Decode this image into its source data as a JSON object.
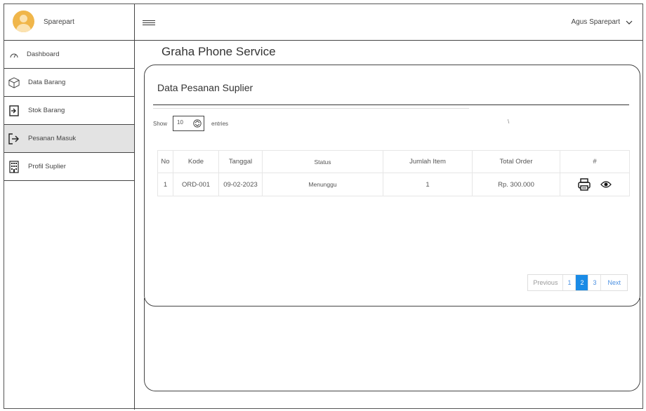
{
  "header": {
    "brand_name": "Sparepart",
    "user_name": "Agus Sparepart"
  },
  "sidebar": {
    "items": [
      {
        "label": "Dashboard",
        "icon": "dashboard-icon",
        "active": false
      },
      {
        "label": "Data Barang",
        "icon": "box-icon",
        "active": false
      },
      {
        "label": "Stok Barang",
        "icon": "login-icon",
        "active": false
      },
      {
        "label": "Pesanan Masuk",
        "icon": "arrow-in-icon",
        "active": true
      },
      {
        "label": "Profil Suplier",
        "icon": "building-icon",
        "active": false
      }
    ]
  },
  "main": {
    "page_title": "Graha Phone Service",
    "card_title": "Data Pesanan Suplier",
    "show_label": "Show",
    "entries_value": "10",
    "entries_label": "entries",
    "stray_mark": "\\",
    "table": {
      "headers": [
        "No",
        "Kode",
        "Tanggal",
        "Status",
        "Jumlah Item",
        "Total Order",
        "#"
      ],
      "rows": [
        {
          "no": "1",
          "kode": "ORD-001",
          "tanggal": "09-02-2023",
          "status": "Menunggu",
          "jumlah": "1",
          "total": "Rp. 300.000"
        }
      ]
    },
    "pagination": {
      "previous": "Previous",
      "pages": [
        "1",
        "2",
        "3"
      ],
      "current": "2",
      "next": "Next"
    }
  },
  "colors": {
    "active_page": "#1a8be6",
    "active_sidebar": "#e3e3e3",
    "avatar": "#f0b64a"
  }
}
